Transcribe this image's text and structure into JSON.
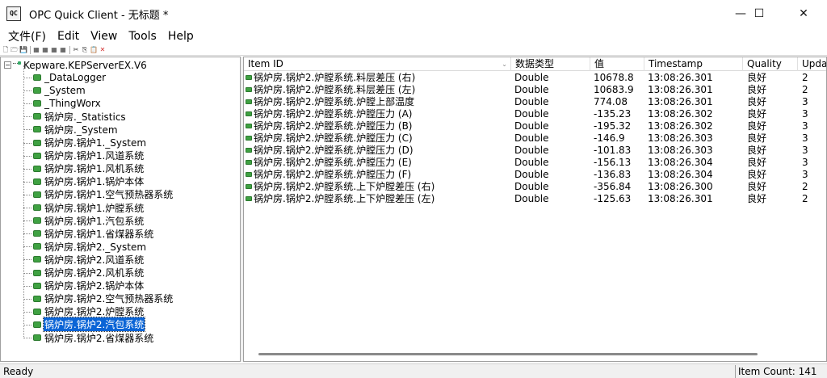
{
  "window": {
    "app_icon_text": "QC",
    "title": "OPC Quick Client - 无标题 *",
    "minimize_glyph": "—",
    "maximize_glyph": "☐",
    "close_glyph": "✕"
  },
  "menu": [
    "文件(F)",
    "Edit",
    "View",
    "Tools",
    "Help"
  ],
  "toolbar": {
    "buttons": [
      "new-file-icon",
      "open-file-icon",
      "save-icon",
      "new-server-icon",
      "new-group-icon",
      "new-item-icon",
      "properties-icon",
      "cut-icon",
      "copy-icon",
      "paste-icon",
      "delete-icon"
    ],
    "glyphs": [
      "🗋",
      "🗁",
      "💾",
      "▦",
      "▦",
      "▦",
      "▦",
      "✂",
      "⎘",
      "📋",
      "✕"
    ],
    "delete_color": "#d32f2f"
  },
  "tree": {
    "root_label": "Kepware.KEPServerEX.V6",
    "root_expander": "−",
    "selected_index": 19,
    "nodes": [
      "_DataLogger",
      "_System",
      "_ThingWorx",
      "锅炉房._Statistics",
      "锅炉房._System",
      "锅炉房.锅炉1._System",
      "锅炉房.锅炉1.风道系统",
      "锅炉房.锅炉1.风机系统",
      "锅炉房.锅炉1.锅炉本体",
      "锅炉房.锅炉1.空气预热器系统",
      "锅炉房.锅炉1.炉膛系统",
      "锅炉房.锅炉1.汽包系统",
      "锅炉房.锅炉1.省煤器系统",
      "锅炉房.锅炉2._System",
      "锅炉房.锅炉2.风道系统",
      "锅炉房.锅炉2.风机系统",
      "锅炉房.锅炉2.锅炉本体",
      "锅炉房.锅炉2.空气预热器系统",
      "锅炉房.锅炉2.炉膛系统",
      "锅炉房.锅炉2.汽包系统",
      "锅炉房.锅炉2.省煤器系统"
    ]
  },
  "list": {
    "columns": [
      "Item ID",
      "数据类型",
      "值",
      "Timestamp",
      "Quality",
      "Update"
    ],
    "sort_indicator": "⌄",
    "rows": [
      [
        "锅炉房.锅炉2.炉膛系统.料层差压 (右)",
        "Double",
        "10678.8",
        "13:08:26.301",
        "良好",
        "2"
      ],
      [
        "锅炉房.锅炉2.炉膛系统.料层差压 (左)",
        "Double",
        "10683.9",
        "13:08:26.301",
        "良好",
        "2"
      ],
      [
        "锅炉房.锅炉2.炉膛系统.炉膛上部温度",
        "Double",
        "774.08",
        "13:08:26.301",
        "良好",
        "3"
      ],
      [
        "锅炉房.锅炉2.炉膛系统.炉膛压力 (A)",
        "Double",
        "-135.23",
        "13:08:26.302",
        "良好",
        "3"
      ],
      [
        "锅炉房.锅炉2.炉膛系统.炉膛压力 (B)",
        "Double",
        "-195.32",
        "13:08:26.302",
        "良好",
        "3"
      ],
      [
        "锅炉房.锅炉2.炉膛系统.炉膛压力 (C)",
        "Double",
        "-146.9",
        "13:08:26.303",
        "良好",
        "3"
      ],
      [
        "锅炉房.锅炉2.炉膛系统.炉膛压力 (D)",
        "Double",
        "-101.83",
        "13:08:26.303",
        "良好",
        "3"
      ],
      [
        "锅炉房.锅炉2.炉膛系统.炉膛压力 (E)",
        "Double",
        "-156.13",
        "13:08:26.304",
        "良好",
        "3"
      ],
      [
        "锅炉房.锅炉2.炉膛系统.炉膛压力 (F)",
        "Double",
        "-136.83",
        "13:08:26.304",
        "良好",
        "3"
      ],
      [
        "锅炉房.锅炉2.炉膛系统.上下炉膛差压 (右)",
        "Double",
        "-356.84",
        "13:08:26.300",
        "良好",
        "2"
      ],
      [
        "锅炉房.锅炉2.炉膛系统.上下炉膛差压 (左)",
        "Double",
        "-125.63",
        "13:08:26.301",
        "良好",
        "2"
      ]
    ]
  },
  "status": {
    "left": "Ready",
    "item_count": "Item Count: 141"
  },
  "colors": {
    "selection": "#0a64d6",
    "item_icon": "#3fa142"
  }
}
